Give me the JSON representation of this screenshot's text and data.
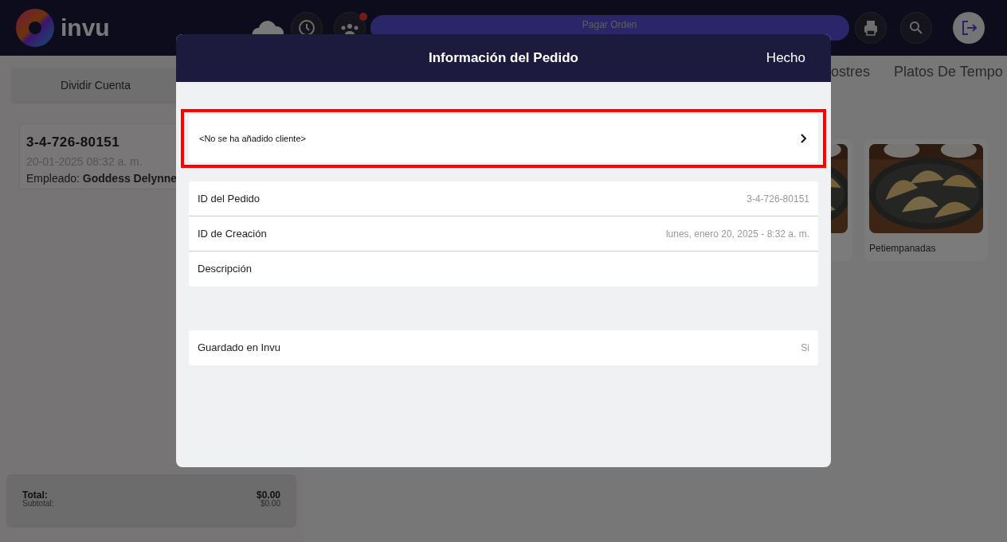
{
  "header": {
    "logo_text": "invu",
    "pay_button": "Pagar Orden",
    "notification": true
  },
  "left_panel": {
    "split_button": "Dividir Cuenta",
    "order": {
      "id": "3-4-726-80151",
      "date": "20-01-2025 08:32 a. m.",
      "employee": "Empleado: **Goddess Delynne**"
    },
    "totals": [
      {
        "kind": "total",
        "label": "Total:",
        "value": "$0.00"
      },
      {
        "kind": "subtotal",
        "label": "Subtotal:",
        "value": "$0.00"
      }
    ]
  },
  "categories": [
    "ostres",
    "Platos De Tempo"
  ],
  "products": [
    {
      "image": {
        "kind": "picture"
      }
    },
    {
      "image": {
        "kind": "picture"
      },
      "name": "Petiempanadas"
    }
  ],
  "modal": {
    "title": "Información del Pedido",
    "done_button": "Hecho",
    "customer_row": {
      "text": "<No se ha añadido cliente>",
      "highlighted": true
    },
    "info_groups": [
      [
        {
          "label": "ID del Pedido",
          "value": "3-4-726-80151"
        },
        {
          "label": "ID de Creación",
          "value": "lunes, enero 20, 2025 - 8:32 a. m."
        },
        {
          "label": "Descripción"
        }
      ],
      [
        {
          "label": "Guardado en Invu",
          "value": "Si"
        }
      ]
    ]
  }
}
